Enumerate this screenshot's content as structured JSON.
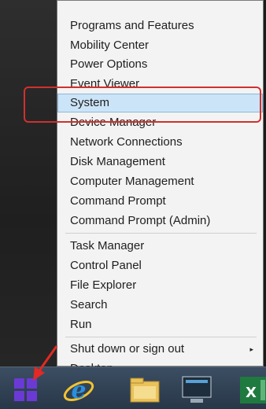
{
  "menu": {
    "items": [
      {
        "label": "Programs and Features"
      },
      {
        "label": "Mobility Center"
      },
      {
        "label": "Power Options"
      },
      {
        "label": "Event Viewer"
      },
      {
        "label": "System"
      },
      {
        "label": "Device Manager"
      },
      {
        "label": "Network Connections"
      },
      {
        "label": "Disk Management"
      },
      {
        "label": "Computer Management"
      },
      {
        "label": "Command Prompt"
      },
      {
        "label": "Command Prompt (Admin)"
      },
      {
        "label": "Task Manager"
      },
      {
        "label": "Control Panel"
      },
      {
        "label": "File Explorer"
      },
      {
        "label": "Search"
      },
      {
        "label": "Run"
      },
      {
        "label": "Shut down or sign out"
      },
      {
        "label": "Desktop"
      }
    ],
    "selected_item": "System",
    "submenu_indicator": "▸"
  },
  "taskbar": {
    "icons": [
      "start-icon",
      "internet-explorer-icon",
      "file-explorer-icon",
      "lenovo-app-icon",
      "excel-icon"
    ]
  },
  "colors": {
    "menu_background": "#f3f3f3",
    "selection": "#cce4f7",
    "annotation": "#d0312d",
    "start_accent": "#6b3ad4"
  }
}
